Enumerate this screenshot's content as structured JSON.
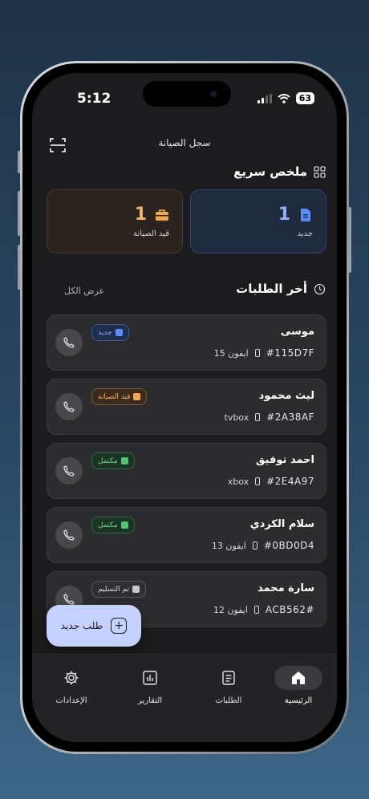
{
  "status_bar": {
    "time": "5:12",
    "battery": "63"
  },
  "header": {
    "title": "سجل الصيانة"
  },
  "summary": {
    "title": "ملخص سريع",
    "new": {
      "count": "1",
      "label": "جديد"
    },
    "in_maintenance": {
      "count": "1",
      "label": "قيد الصيانة"
    }
  },
  "recent": {
    "title": "أخر الطلبات",
    "view_all": "عرض الكل",
    "orders": [
      {
        "name": "موسى",
        "code": "#115D7F",
        "device": "ايفون 15",
        "status": "جديد"
      },
      {
        "name": "ليث محمود",
        "code": "#2A38AF",
        "device": "tvbox",
        "status": "قيد الصيانة"
      },
      {
        "name": "احمد توفيق",
        "code": "#2E4A97",
        "device": "xbox",
        "status": "مكتمل"
      },
      {
        "name": "سلام الكردي",
        "code": "#0BD0D4",
        "device": "ايفون 13",
        "status": "مكتمل"
      },
      {
        "name": "سارة محمد",
        "code": "ACB562#",
        "device": "ايفون 12",
        "status": "تم التسليم"
      }
    ]
  },
  "fab": {
    "label": "طلب جديد"
  },
  "tabs": [
    {
      "label": "الرئيسية",
      "active": true
    },
    {
      "label": "الطلبات"
    },
    {
      "label": "التقارير"
    },
    {
      "label": "الإعدادات"
    }
  ],
  "colors": {
    "accent": "#c5d1ff",
    "new": "#8fb3ff",
    "maintenance": "#f0b565",
    "done": "#6fdc8c"
  }
}
